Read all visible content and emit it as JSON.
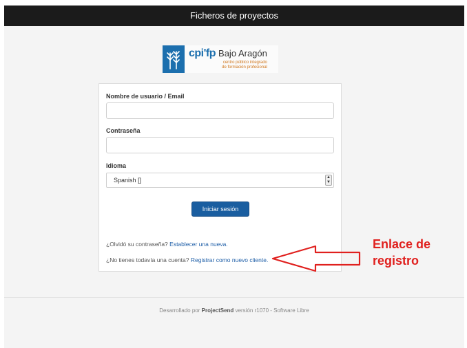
{
  "header": {
    "title": "Ficheros de proyectos"
  },
  "logo": {
    "acronym": "cpi'fp",
    "name": "Bajo Aragón",
    "subtitle_line1": "centro público integrado",
    "subtitle_line2": "de formación profesional"
  },
  "form": {
    "username_label": "Nombre de usuario / Email",
    "username_value": "",
    "password_label": "Contraseña",
    "password_value": "",
    "language_label": "Idioma",
    "language_selected": "Spanish []",
    "submit_label": "Iniciar sesión"
  },
  "help": {
    "forgot_text": "¿Olvidó su contraseña?",
    "forgot_link": "Establecer una nueva.",
    "register_text": "¿No tienes todavía una cuenta?",
    "register_link": "Registrar como nuevo cliente."
  },
  "footer": {
    "prefix": "Desarrollado por",
    "brand": "ProjectSend",
    "suffix": "versión r1070 - Software Libre"
  },
  "annotation": {
    "line1": "Enlace de",
    "line2": "registro",
    "color": "#e0201e"
  },
  "colors": {
    "header_bg": "#1b1b1b",
    "button_bg": "#1a5ea0",
    "link": "#1f5fa8",
    "logo_blue": "#1c6fae"
  }
}
